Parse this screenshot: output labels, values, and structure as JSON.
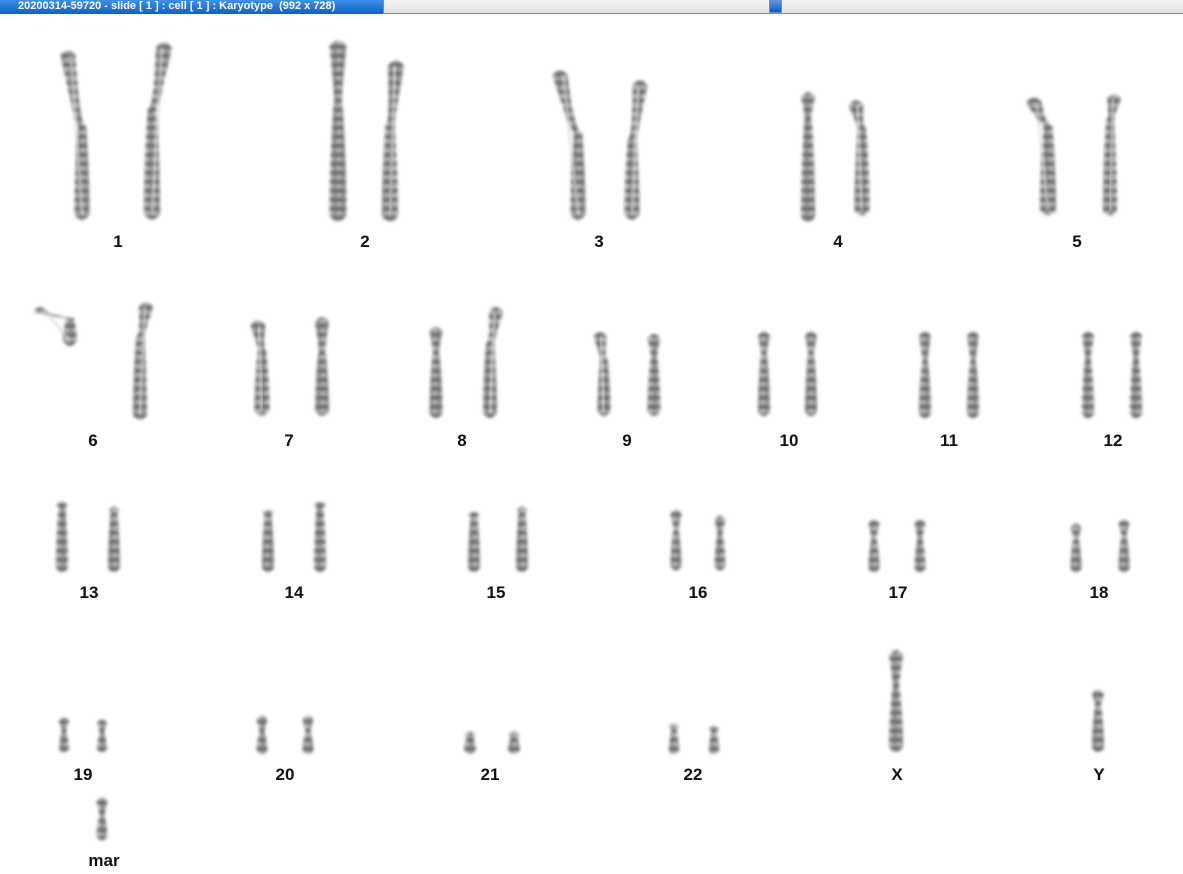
{
  "window": {
    "title": "20200314-59720 - slide [ 1 ] : cell [ 1 ] : Karyotype  (992 x 728)"
  },
  "karyotype": {
    "labels": [
      "1",
      "2",
      "3",
      "4",
      "5",
      "6",
      "7",
      "8",
      "9",
      "10",
      "11",
      "12",
      "13",
      "14",
      "15",
      "16",
      "17",
      "18",
      "19",
      "20",
      "21",
      "22",
      "X",
      "Y",
      "mar"
    ]
  }
}
